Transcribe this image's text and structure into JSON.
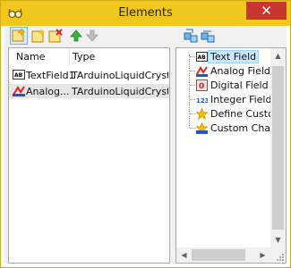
{
  "window": {
    "title": "Elements",
    "close_label": "✕"
  },
  "list": {
    "columns": [
      "Name",
      "Type"
    ],
    "rows": [
      {
        "name": "TextField1",
        "type": "TArduinoLiquidCrystal..."
      },
      {
        "name": "Analog...",
        "type": "TArduinoLiquidCrystal..."
      }
    ]
  },
  "tree": {
    "items": [
      {
        "label": "Text Field",
        "icon": "text-field-icon"
      },
      {
        "label": "Analog Field",
        "icon": "analog-field-icon"
      },
      {
        "label": "Digital Field",
        "icon": "digital-field-icon"
      },
      {
        "label": "Integer Field",
        "icon": "integer-field-icon"
      },
      {
        "label": "Define Custom Chara",
        "icon": "define-custom-character-icon"
      },
      {
        "label": "Custom Character Fi",
        "icon": "custom-character-field-icon"
      }
    ]
  },
  "colors": {
    "titlebar": "#f0c71a",
    "close": "#c7372f",
    "selection": "#cce8ff"
  }
}
